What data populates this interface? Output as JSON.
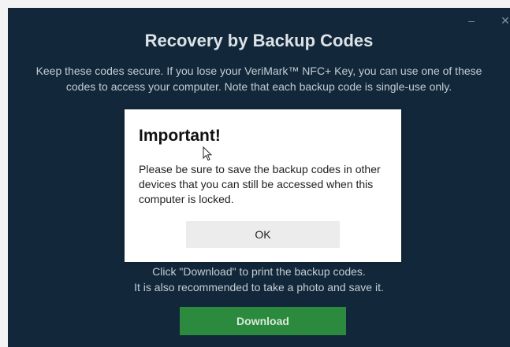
{
  "window": {
    "title": "Recovery by Backup Codes",
    "minimize_glyph": "–",
    "close_glyph": "✕",
    "description": "Keep these codes secure. If you lose your VeriMark™ NFC+ Key, you can use one of these codes to access your computer. Note that each backup code is single-use only.",
    "hint_line_1": "Click \"Download\" to print the backup codes.",
    "hint_line_2": "It is also recommended to take a photo and save it.",
    "download_label": "Download"
  },
  "dialog": {
    "title": "Important!",
    "message": "Please be sure to save the backup codes in other devices that you can still be accessed when this computer is locked.",
    "ok_label": "OK"
  },
  "colors": {
    "window_background": "#12283a",
    "download_button": "#2b8a3e",
    "dialog_background": "#ffffff",
    "ok_button": "#ececec"
  },
  "icons": {
    "minimize": "minimize-icon",
    "close": "close-icon",
    "pointer": "mouse-pointer-icon"
  }
}
